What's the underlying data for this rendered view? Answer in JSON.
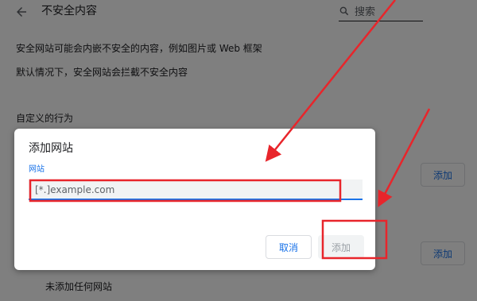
{
  "header": {
    "title": "不安全内容",
    "search_placeholder": "搜索",
    "icons": [
      "back-arrow-icon",
      "search-icon"
    ]
  },
  "content": {
    "description_1": "安全网站可能会内嵌不安全的内容，例如图片或 Web 框架",
    "description_2": "默认情况下，安全网站会拦截不安全内容",
    "custom_behavior_heading": "自定义的行为",
    "add_button_label": "添加",
    "empty_note": "未添加任何网站"
  },
  "dialog": {
    "title": "添加网站",
    "field_label": "网站",
    "field_placeholder": "[*.]example.com",
    "cancel_label": "取消",
    "add_label": "添加"
  },
  "colors": {
    "accent": "#1a73e8",
    "annotation": "#e8252b",
    "scrim": "rgba(0,0,0,0.5)",
    "disabled_text": "#9aa0a6"
  }
}
